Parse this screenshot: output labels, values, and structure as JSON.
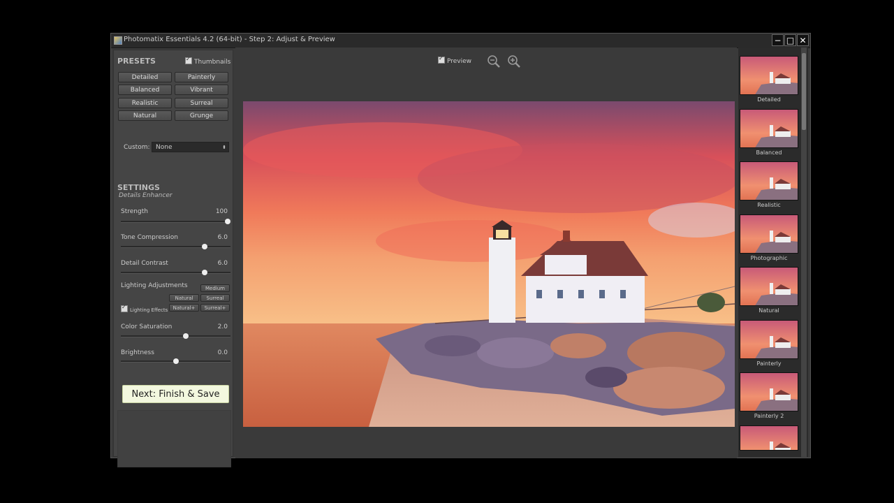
{
  "window": {
    "title": "Photomatix Essentials 4.2 (64-bit) - Step 2: Adjust & Preview",
    "minimize": "−",
    "maximize": "□",
    "close": "✕"
  },
  "presets": {
    "title": "PRESETS",
    "thumbnails_label": "Thumbnails",
    "buttons": [
      "Detailed",
      "Painterly",
      "Balanced",
      "Vibrant",
      "Realistic",
      "Surreal",
      "Natural",
      "Grunge"
    ],
    "custom_label": "Custom:",
    "custom_value": "None"
  },
  "settings": {
    "title": "SETTINGS",
    "subtitle": "Details Enhancer",
    "strength": {
      "label": "Strength",
      "value": "100",
      "level": 1.0
    },
    "tone_compression": {
      "label": "Tone Compression",
      "value": "6.0",
      "level": 0.78
    },
    "detail_contrast": {
      "label": "Detail Contrast",
      "value": "6.0",
      "level": 0.78
    },
    "lighting": {
      "label": "Lighting Adjustments",
      "buttons": [
        "Medium",
        "Natural",
        "Surreal",
        "Natural+",
        "Surreal+"
      ],
      "effects_label": "Lighting Effects"
    },
    "color_saturation": {
      "label": "Color Saturation",
      "value": "2.0",
      "level": 0.6
    },
    "brightness": {
      "label": "Brightness",
      "value": "0.0",
      "level": 0.5
    }
  },
  "next_button": "Next: Finish & Save",
  "preview": {
    "label": "Preview"
  },
  "thumbnails": [
    "Detailed",
    "Balanced",
    "Realistic",
    "Photographic",
    "Natural",
    "Painterly",
    "Painterly 2"
  ],
  "icons": {
    "zoom_out": "zoom-out-icon",
    "zoom_in": "zoom-in-icon",
    "app": "photomatix-icon"
  }
}
